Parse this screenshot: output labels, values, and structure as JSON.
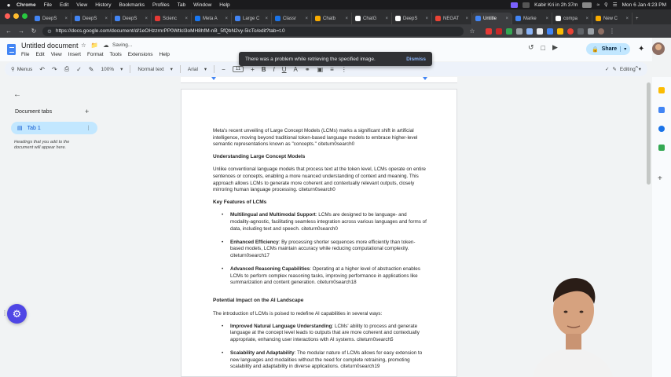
{
  "menubar": {
    "apple": "",
    "items": [
      "Chrome",
      "File",
      "Edit",
      "View",
      "History",
      "Bookmarks",
      "Profiles",
      "Tab",
      "Window",
      "Help"
    ],
    "user_status": "Kabir Kri in 2h 37m",
    "datetime": "Mon 6 Jan 4:23 PM"
  },
  "browser": {
    "tabs": [
      {
        "label": "DeepS",
        "color": "#4285f4"
      },
      {
        "label": "DeepS",
        "color": "#4285f4"
      },
      {
        "label": "DeepS",
        "color": "#4285f4"
      },
      {
        "label": "Scienc",
        "color": "#e53935"
      },
      {
        "label": "Meta A",
        "color": "#1877f2"
      },
      {
        "label": "Large C",
        "color": "#4285f4"
      },
      {
        "label": "Classr",
        "color": "#1a73e8"
      },
      {
        "label": "Chatb",
        "color": "#f9ab00"
      },
      {
        "label": "ChatG",
        "color": "#ffffff"
      },
      {
        "label": "DeepS",
        "color": "#ffffff"
      },
      {
        "label": "NEGAT",
        "color": "#ea4335"
      },
      {
        "label": "Untitle",
        "color": "#4285f4"
      },
      {
        "label": "Marke",
        "color": "#4285f4"
      },
      {
        "label": "compa",
        "color": "#ffffff"
      },
      {
        "label": "New C",
        "color": "#f9ab00"
      }
    ],
    "active_tab_index": 11,
    "url": "https://docs.google.com/document/d/1eOHzzrnrPP0Wtlcl3oMH8hfM-nB_5fQbN2vy-5lcTo/edit?tab=t.0"
  },
  "docs": {
    "title": "Untitled document",
    "status": "Saving...",
    "menus": [
      "File",
      "Edit",
      "View",
      "Insert",
      "Format",
      "Tools",
      "Extensions",
      "Help"
    ],
    "share_label": "Share",
    "toolbar": {
      "menus_label": "Menus",
      "zoom": "100%",
      "style": "Normal text",
      "font": "Arial",
      "font_size": "11",
      "mode": "Editing"
    }
  },
  "snackbar": {
    "message": "There was a problem while retrieving the specified image.",
    "action": "Dismiss"
  },
  "tabs_panel": {
    "title": "Document tabs",
    "active_tab": "Tab 1",
    "note": "Headings that you add to the document will appear here."
  },
  "document": {
    "intro": "Meta's recent unveiling of Large Concept Models (LCMs) marks a significant shift in artificial intelligence, moving beyond traditional token-based language models to embrace higher-level semantic representations known as \"concepts.\" citeturn0search0",
    "h1": "Understanding Large Concept Models",
    "p1": "Unlike conventional language models that process text at the token level, LCMs operate on entire sentences or concepts, enabling a more nuanced understanding of context and meaning. This approach allows LCMs to generate more coherent and contextually relevant outputs, closely mirroring human language processing. citeturn0search0",
    "h2": "Key Features of LCMs",
    "features": [
      {
        "title": "Multilingual and Multimodal Support",
        "text": ": LCMs are designed to be language- and modality-agnostic, facilitating seamless integration across various languages and forms of data, including text and speech. citeturn0search0"
      },
      {
        "title": "Enhanced Efficiency",
        "text": ": By processing shorter sequences more efficiently than token-based models, LCMs maintain accuracy while reducing computational complexity. citeturn0search17"
      },
      {
        "title": "Advanced Reasoning Capabilities",
        "text": ": Operating at a higher level of abstraction enables LCMs to perform complex reasoning tasks, improving performance in applications like summarization and content generation. citeturn0search18"
      }
    ],
    "h3": "Potential Impact on the AI Landscape",
    "p2": "The introduction of LCMs is poised to redefine AI capabilities in several ways:",
    "impacts": [
      {
        "title": "Improved Natural Language Understanding",
        "text": ": LCMs' ability to process and generate language at the concept level leads to outputs that are more coherent and contextually appropriate, enhancing user interactions with AI systems. citeturn0search5"
      },
      {
        "title": "Scalability and Adaptability",
        "text": ": The modular nature of LCMs allows for easy extension to new languages and modalities without the need for complete retraining, promoting scalability and adaptability in diverse applications. citeturn0search19"
      }
    ]
  },
  "colors": {
    "accent": "#0b57d0",
    "share_bg": "#c2e7ff",
    "fab": "#4f46e5"
  }
}
